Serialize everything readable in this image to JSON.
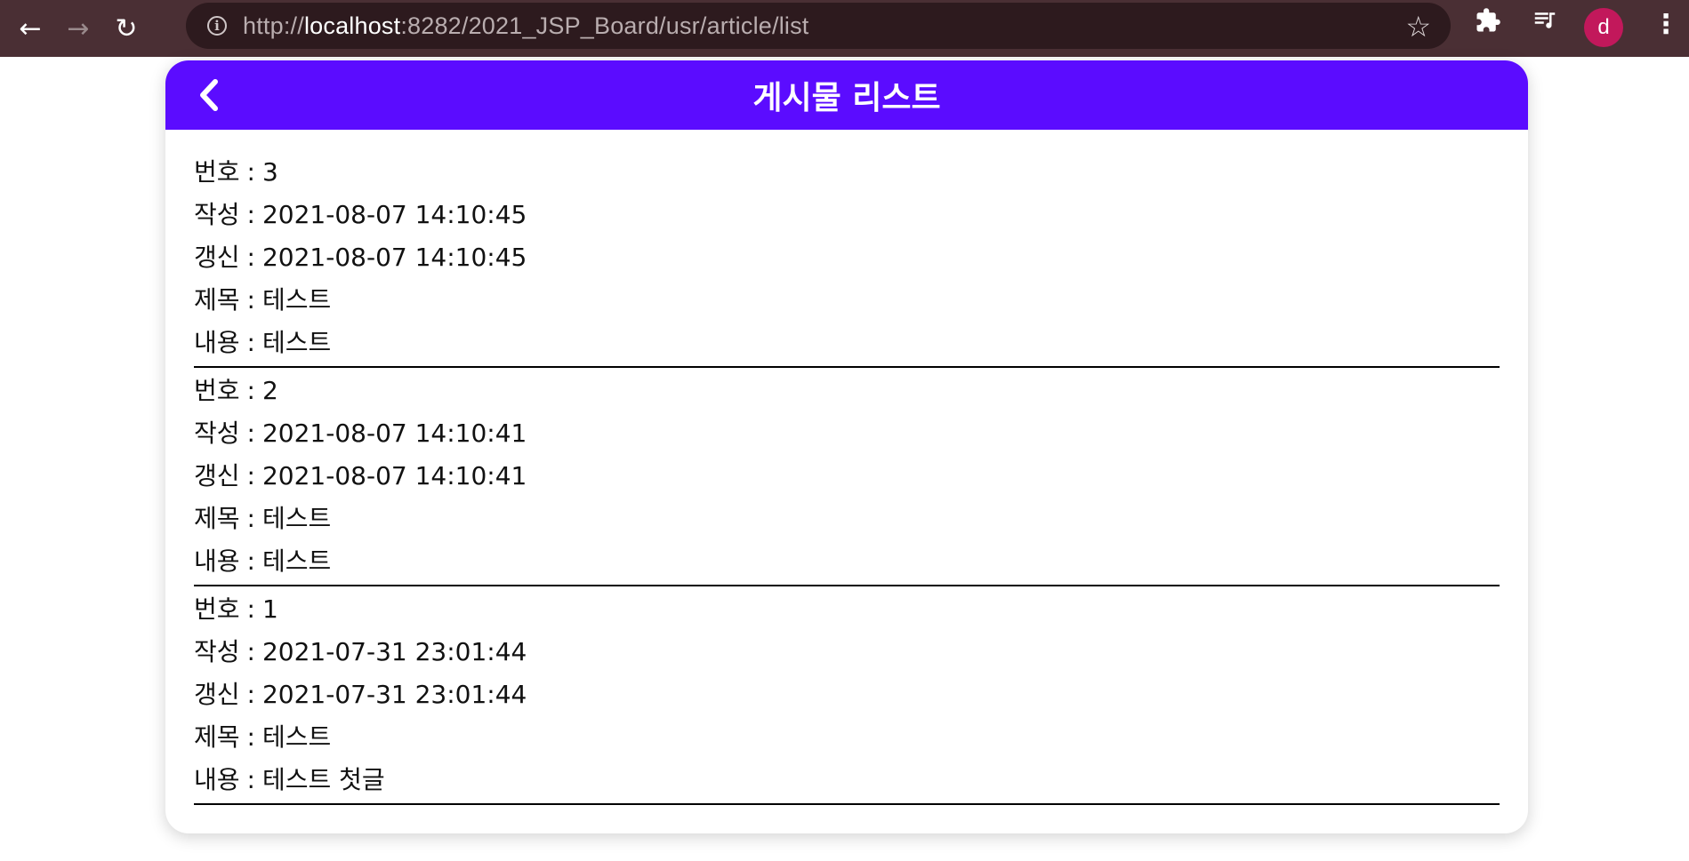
{
  "browser": {
    "url_prefix": "http://",
    "url_host": "localhost",
    "url_rest": ":8282/2021_JSP_Board/usr/article/list",
    "avatar_letter": "d",
    "back_icon": "arrow-left-icon",
    "forward_icon": "arrow-right-icon",
    "reload_icon": "reload-icon",
    "info_icon": "info-icon",
    "star_icon": "star-icon",
    "extensions_icon": "puzzle-icon",
    "media_icon": "media-queue-icon",
    "menu_icon": "kebab-menu-icon"
  },
  "page": {
    "title": "게시물 리스트",
    "back_icon": "chevron-left-icon",
    "header_color": "#5b0cff"
  },
  "labels": {
    "id": "번호",
    "reg_date": "작성",
    "update_date": "갱신",
    "title": "제목",
    "body": "내용",
    "separator": ":"
  },
  "articles": [
    {
      "id": "3",
      "reg_date": "2021-08-07 14:10:45",
      "update_date": "2021-08-07 14:10:45",
      "title": "테스트",
      "body": "테스트"
    },
    {
      "id": "2",
      "reg_date": "2021-08-07 14:10:41",
      "update_date": "2021-08-07 14:10:41",
      "title": "테스트",
      "body": "테스트"
    },
    {
      "id": "1",
      "reg_date": "2021-07-31 23:01:44",
      "update_date": "2021-07-31 23:01:44",
      "title": "테스트",
      "body": "테스트 첫글"
    }
  ]
}
